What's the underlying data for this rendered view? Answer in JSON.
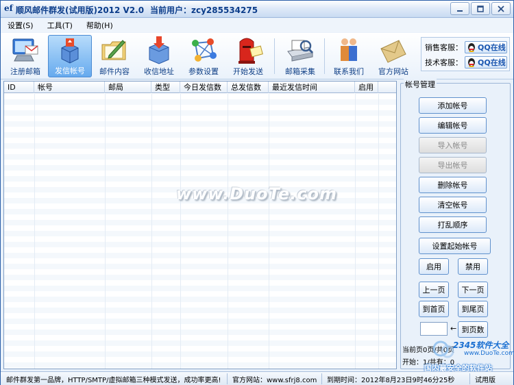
{
  "titlebar": {
    "app_title": "顺风邮件群发(试用版)2012 V2.0",
    "current_user": "当前用户：zcy285534275",
    "logo_text": "ef"
  },
  "menu": [
    {
      "label": "设置(S)"
    },
    {
      "label": "工具(T)"
    },
    {
      "label": "帮助(H)"
    }
  ],
  "toolbar": {
    "items": [
      {
        "label": "注册邮箱",
        "icon": "computer-mail-icon"
      },
      {
        "label": "发信帐号",
        "icon": "account-disk-icon"
      },
      {
        "label": "邮件内容",
        "icon": "folder-pen-icon"
      },
      {
        "label": "收信地址",
        "icon": "mailbox-download-icon"
      },
      {
        "label": "参数设置",
        "icon": "network-settings-icon"
      },
      {
        "label": "开始发送",
        "icon": "red-postbox-icon"
      },
      {
        "label": "邮箱采集",
        "icon": "scanner-icon"
      },
      {
        "label": "联系我们",
        "icon": "people-icon"
      },
      {
        "label": "官方网站",
        "icon": "envelope-icon"
      }
    ],
    "active_index": 1,
    "support": {
      "sales_label": "销售客服：",
      "tech_label": "技术客服：",
      "qq_label": "QQ在线"
    }
  },
  "table": {
    "columns": [
      "ID",
      "帐号",
      "邮局",
      "类型",
      "今日发信数",
      "总发信数",
      "最近发信时间",
      "启用"
    ],
    "rows": []
  },
  "watermark": "www.DuoTe.com",
  "panel": {
    "title": "帐号管理",
    "add": "添加帐号",
    "edit": "编辑帐号",
    "import": "导入帐号",
    "export": "导出帐号",
    "delete": "删除帐号",
    "clear": "清空帐号",
    "shuffle": "打乱顺序",
    "set_start": "设置起始帐号",
    "enable": "启用",
    "disable": "禁用",
    "prev": "上一页",
    "next": "下一页",
    "first": "到首页",
    "last": "到尾页",
    "goto": "到页数",
    "page_input": "",
    "page_info": "当前页0页/共0页",
    "start_info": "开始：1/共有：0"
  },
  "brand": {
    "name": "2345软件大全",
    "url": "www.DuoTe.com",
    "slogan": "国内最安全的软件站"
  },
  "status": {
    "slogan": "邮件群发第一品牌，HTTP/SMTP/虚拟邮箱三种模式发送，成功率更高!",
    "website": "官方网站：www.sfrj8.com",
    "expiry": "到期时间：2012年8月23日9时46分25秒",
    "edition": "试用版"
  },
  "colors": {
    "accent": "#1a56b0",
    "active_tab": "#66aaee",
    "window_bg": "#e9f1fa"
  }
}
